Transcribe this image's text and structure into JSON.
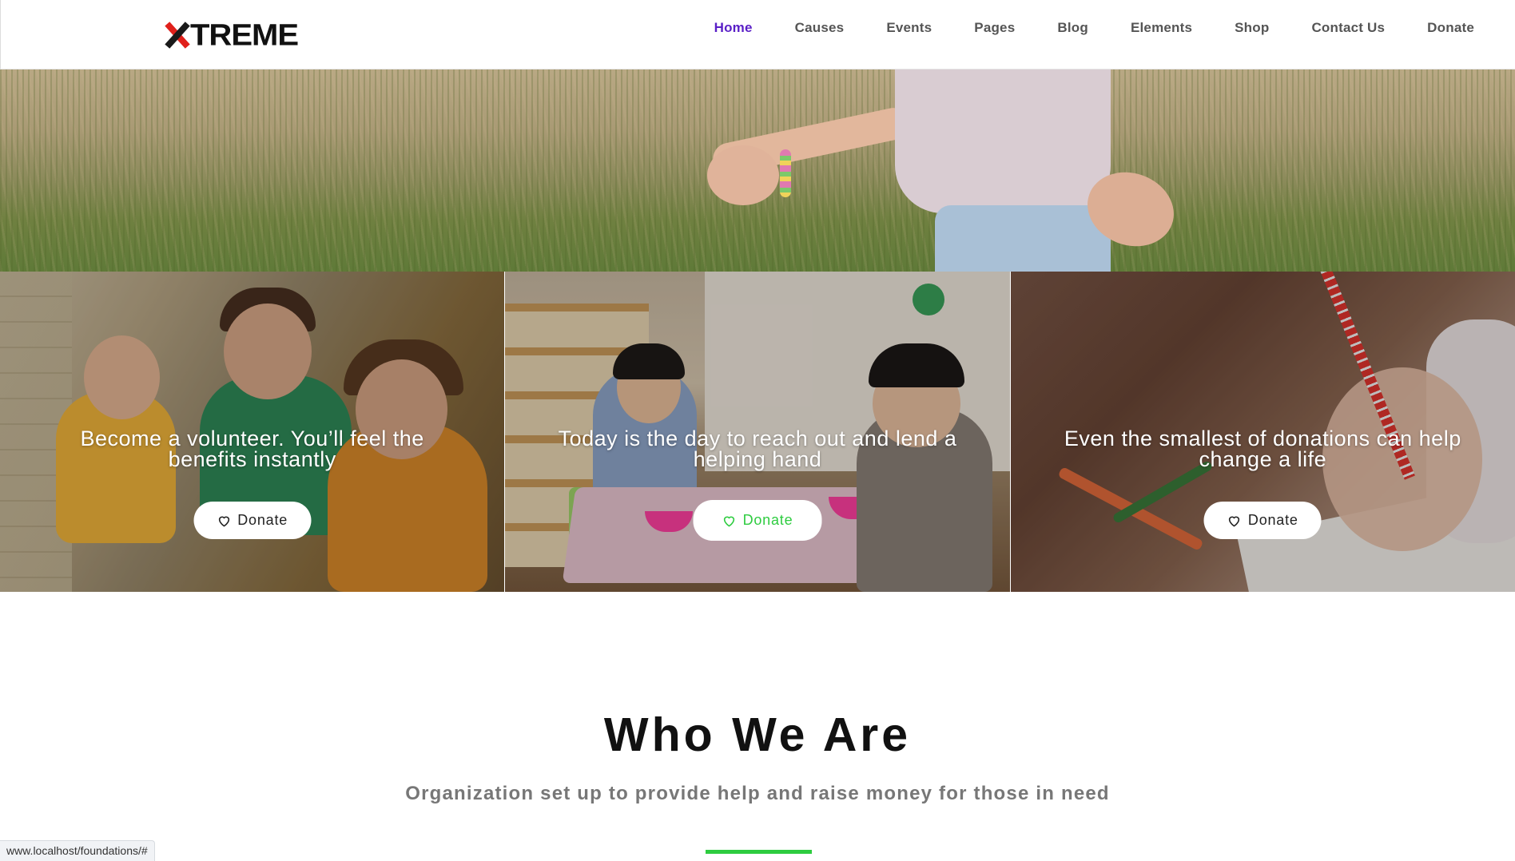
{
  "brand": {
    "logo_text": "TREME",
    "logo_mark": "X",
    "accent_red": "#e0201b"
  },
  "nav": {
    "items": [
      {
        "label": "Home",
        "active": true
      },
      {
        "label": "Causes",
        "active": false
      },
      {
        "label": "Events",
        "active": false
      },
      {
        "label": "Pages",
        "active": false
      },
      {
        "label": "Blog",
        "active": false
      },
      {
        "label": "Elements",
        "active": false
      },
      {
        "label": "Shop",
        "active": false
      },
      {
        "label": "Contact Us",
        "active": false
      },
      {
        "label": "Donate",
        "active": false
      }
    ],
    "active_color": "#5a1fc7"
  },
  "cards": [
    {
      "title": "Become a volunteer. You’ll feel the benefits instantly",
      "button_label": "Donate",
      "button_icon": "heart-outline-icon"
    },
    {
      "title": "Today is the day to reach out and lend a helping hand",
      "button_label": "Donate",
      "button_icon": "heart-outline-icon",
      "hovered": true
    },
    {
      "title": "Even the smallest of donations can help change a life",
      "button_label": "Donate",
      "button_icon": "heart-outline-icon"
    }
  ],
  "who": {
    "title": "Who We Are",
    "subtitle": "Organization set up to provide help and raise money for those in need",
    "divider_color": "#2ecc40"
  },
  "status_bar": {
    "url": "www.localhost/foundations/#"
  }
}
